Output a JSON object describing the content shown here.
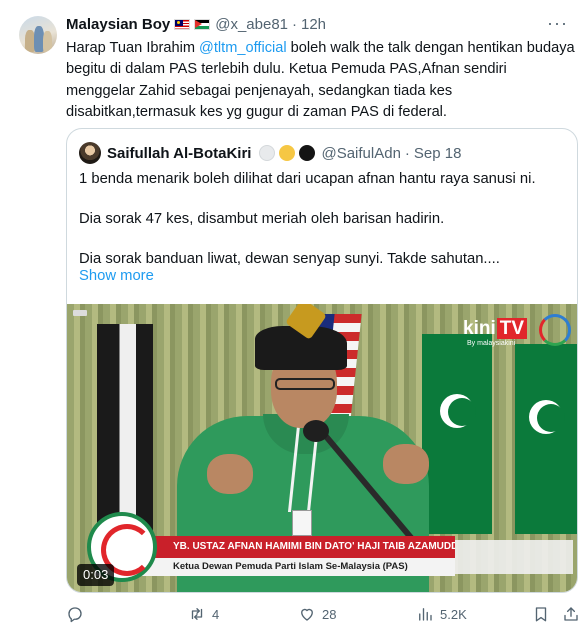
{
  "tweet": {
    "display_name": "Malaysian Boy",
    "flags": [
      "malaysia-flag",
      "palestine-flag"
    ],
    "handle": "@x_abe81",
    "separator": "·",
    "time": "12h",
    "text_before": "Harap Tuan Ibrahim ",
    "mention": "@tltm_official",
    "text_after": " boleh walk the talk dengan hentikan budaya begitu di dalam PAS terlebih dulu. Ketua Pemuda PAS,Afnan sendiri menggelar Zahid sebagai penjenayah, sedangkan tiada kes disabitkan,termasuk kes yg gugur di zaman PAS di federal."
  },
  "quote": {
    "display_name": "Saifullah Al-BotaKiri",
    "status_circles": [
      "white",
      "yellow",
      "black"
    ],
    "handle": "@SaifulAdn",
    "separator": "·",
    "date": "Sep 18",
    "paragraphs": [
      "1 benda menarik boleh dilihat dari ucapan afnan hantu raya sanusi ni.",
      "Dia sorak 47 kes, disambut meriah oleh barisan hadirin.",
      "Dia sorak banduan liwat, dewan senyap sunyi. Takde sahutan...."
    ],
    "show_more": "Show more",
    "video": {
      "duration": "0:03",
      "brand_kini": "kini",
      "brand_tv": "TV",
      "brand_sub": "By malaysiakini",
      "lower_third_name": "YB. USTAZ AFNAN HAMIMI BIN DATO' HAJI TAIB AZAMUDDEN",
      "lower_third_title": "Ketua Dewan Pemuda Parti Islam Se-Malaysia (PAS)"
    }
  },
  "actions": {
    "reply": {
      "icon": "reply-icon",
      "count": ""
    },
    "retweet": {
      "icon": "retweet-icon",
      "count": "4"
    },
    "like": {
      "icon": "heart-icon",
      "count": "28"
    },
    "views": {
      "icon": "views-icon",
      "count": "5.2K"
    },
    "bookmark": {
      "icon": "bookmark-icon",
      "count": ""
    },
    "share": {
      "icon": "share-icon",
      "count": ""
    }
  },
  "colors": {
    "link": "#1d9bf0",
    "secondary_text": "#536471",
    "primary_text": "#0f1419",
    "border": "#cfd9de"
  }
}
